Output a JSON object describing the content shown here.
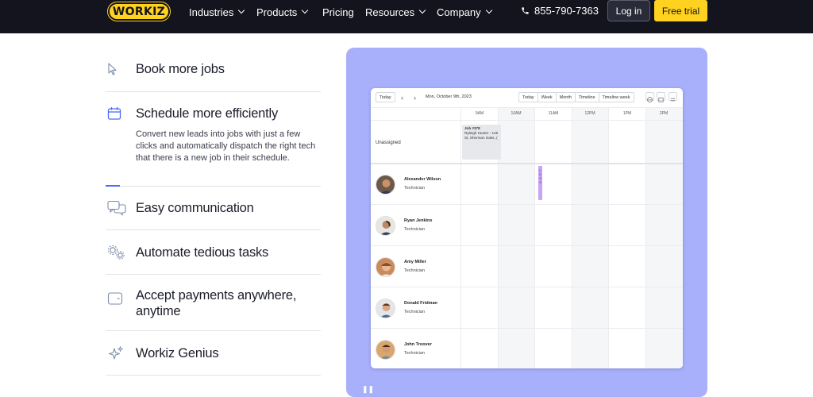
{
  "nav": {
    "logo": "WORKIZ",
    "items": [
      {
        "label": "Industries",
        "dropdown": true
      },
      {
        "label": "Products",
        "dropdown": true
      },
      {
        "label": "Pricing",
        "dropdown": false
      },
      {
        "label": "Resources",
        "dropdown": true
      },
      {
        "label": "Company",
        "dropdown": true
      }
    ],
    "phone": "855-790-7363",
    "login": "Log in",
    "trial": "Free trial"
  },
  "features": [
    {
      "title": "Book more jobs",
      "icon": "cursor-icon"
    },
    {
      "title": "Schedule more efficiently",
      "icon": "calendar-icon",
      "active": true,
      "description": "Convert new leads into jobs with just a few clicks and automatically dispatch the right tech that there is a new job in their schedule."
    },
    {
      "title": "Easy communication",
      "icon": "chat-icon"
    },
    {
      "title": "Automate tedious tasks",
      "icon": "gears-icon"
    },
    {
      "title": "Accept payments anywhere, anytime",
      "icon": "wallet-icon"
    },
    {
      "title": "Workiz Genius",
      "icon": "sparkle-icon"
    }
  ],
  "scheduler": {
    "today_button": "Today",
    "date": "Mon, October 9th, 2023",
    "views": [
      "Today",
      "Week",
      "Month",
      "Timeline",
      "Timeline week"
    ],
    "times": [
      "9AM",
      "10AM",
      "11AM",
      "12PM",
      "1PM",
      "2PM"
    ],
    "unassigned_label": "Unassigned",
    "job": {
      "title": "Job #378",
      "line1": "Ryleigh Hunter - 145",
      "line2": "St, Sherman Oaks, ("
    },
    "technicians": [
      {
        "name": "Alexander Wilson",
        "role": "Technician"
      },
      {
        "name": "Ryan Jenkins",
        "role": "Technician"
      },
      {
        "name": "Amy Miller",
        "role": "Technician"
      },
      {
        "name": "Donald Fridman",
        "role": "Technician"
      },
      {
        "name": "John Troover",
        "role": "Technician"
      }
    ],
    "assigned_pill": "L C 9 9"
  },
  "colors": {
    "nav_bg": "#14141f",
    "brand_yellow": "#ffd21f",
    "panel_bg": "#a9b0fb",
    "accent_blue": "#4a6cf7"
  }
}
